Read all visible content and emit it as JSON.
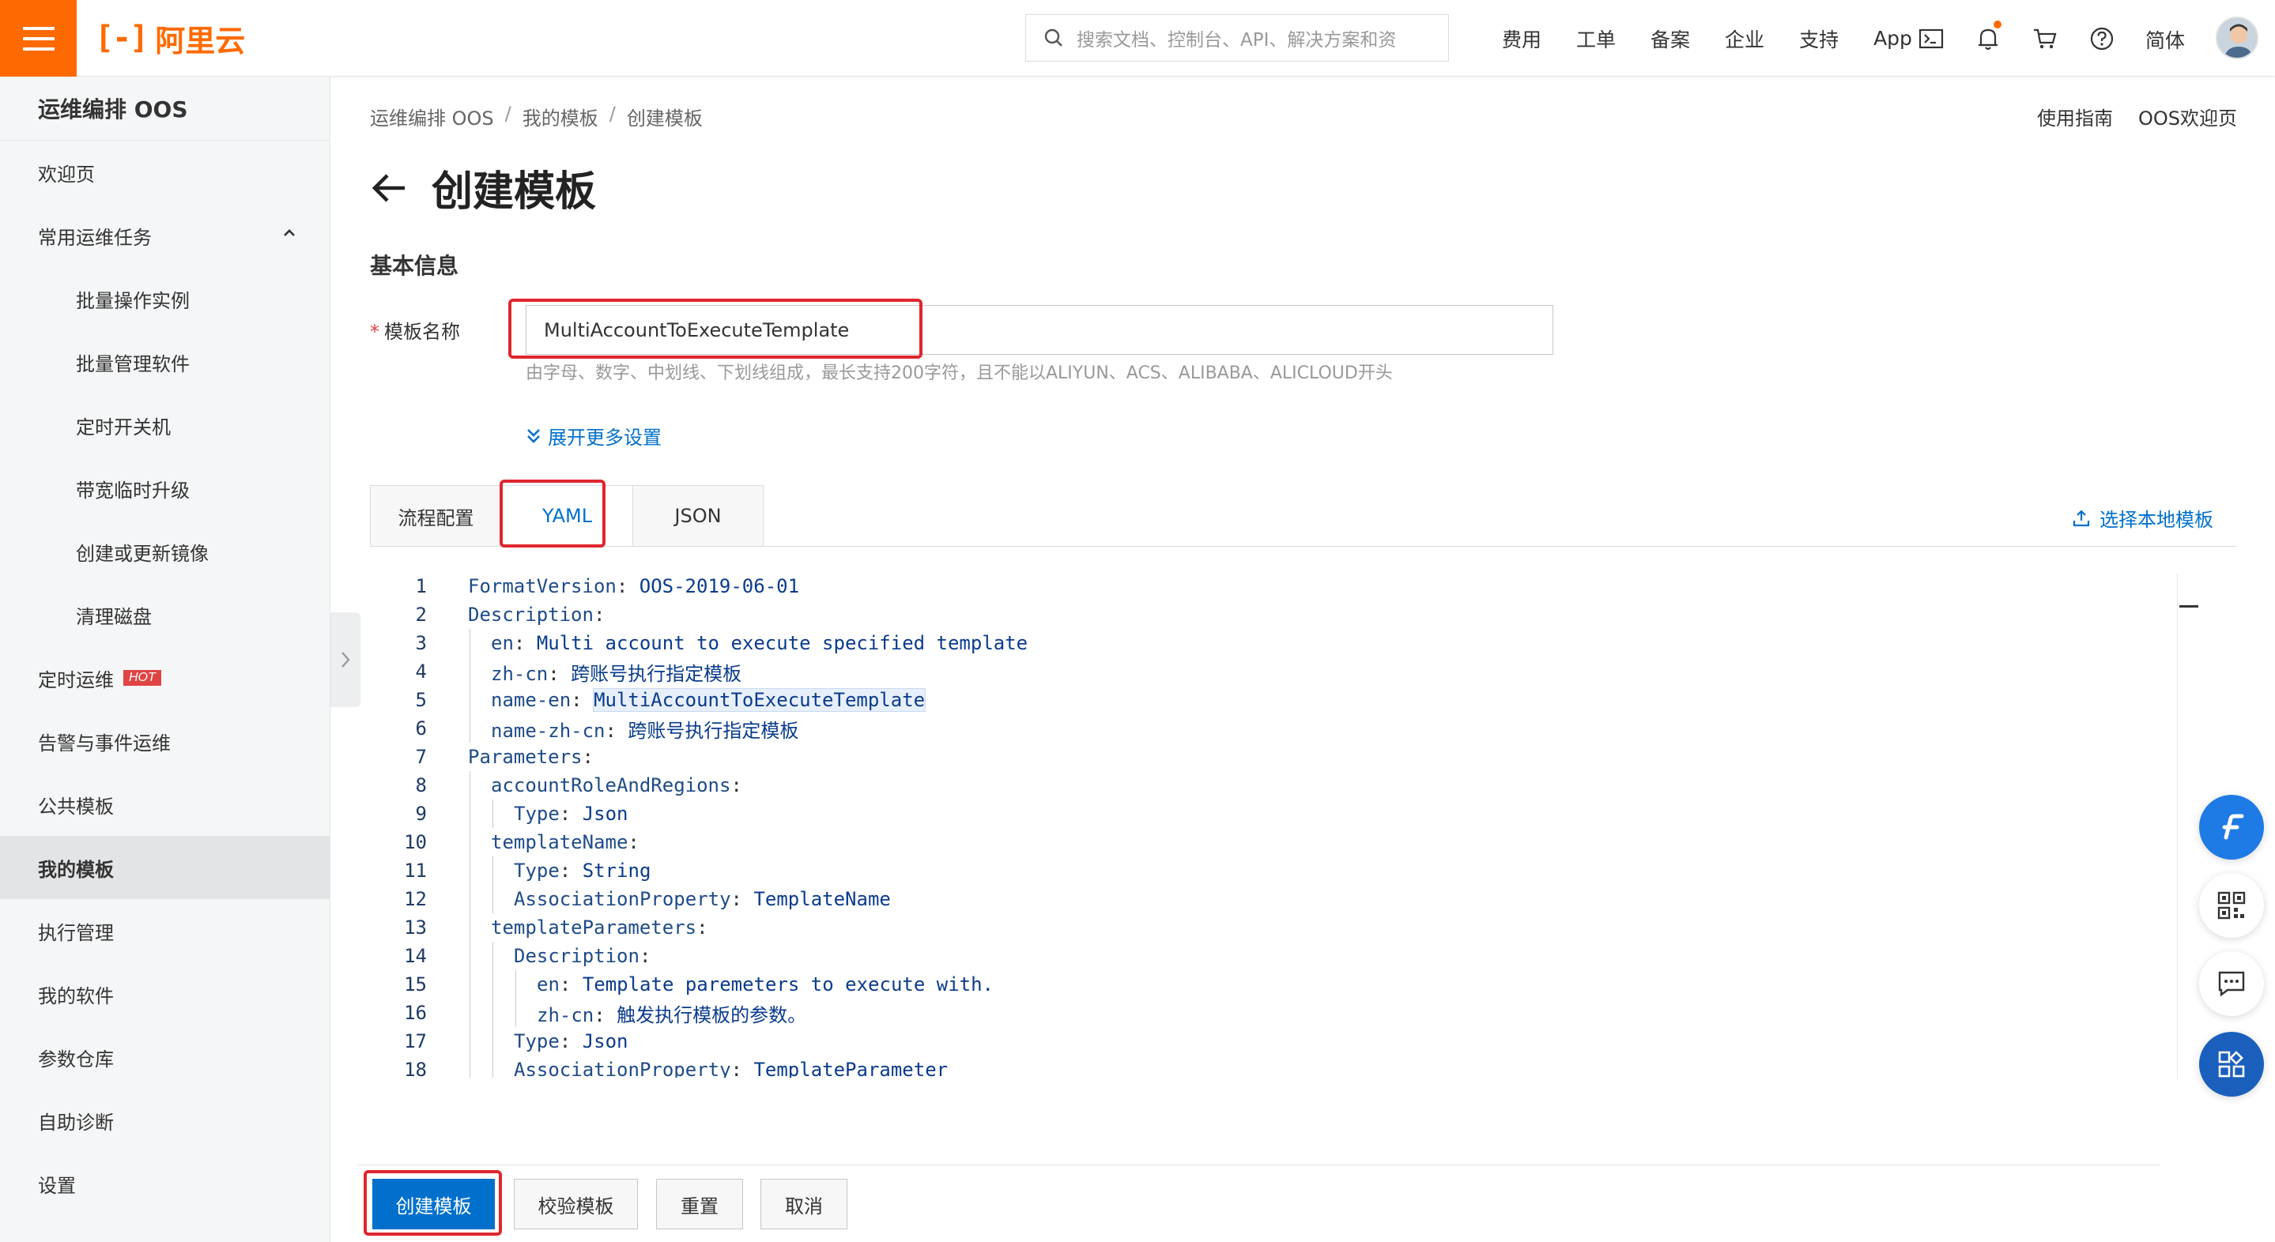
{
  "header": {
    "logo_mark": "[-]",
    "logo_text": "阿里云",
    "search_placeholder": "搜索文档、控制台、API、解决方案和资",
    "links": [
      "费用",
      "工单",
      "备案",
      "企业",
      "支持",
      "App"
    ],
    "language": "简体"
  },
  "sidebar": {
    "title": "运维编排 OOS",
    "items": [
      {
        "label": "欢迎页"
      },
      {
        "label": "常用运维任务"
      },
      {
        "label": "批量操作实例"
      },
      {
        "label": "批量管理软件"
      },
      {
        "label": "定时开关机"
      },
      {
        "label": "带宽临时升级"
      },
      {
        "label": "创建或更新镜像"
      },
      {
        "label": "清理磁盘"
      },
      {
        "label": "定时运维",
        "badge": "HOT"
      },
      {
        "label": "告警与事件运维"
      },
      {
        "label": "公共模板"
      },
      {
        "label": "我的模板"
      },
      {
        "label": "执行管理"
      },
      {
        "label": "我的软件"
      },
      {
        "label": "参数仓库"
      },
      {
        "label": "自助诊断"
      },
      {
        "label": "设置"
      }
    ]
  },
  "breadcrumb": [
    "运维编排 OOS",
    "我的模板",
    "创建模板"
  ],
  "help_links": [
    "使用指南",
    "OOS欢迎页"
  ],
  "page_title": "创建模板",
  "section_title": "基本信息",
  "form": {
    "name_label": "模板名称",
    "name_value": "MultiAccountToExecuteTemplate",
    "name_hint": "由字母、数字、中划线、下划线组成，最长支持200字符，且不能以ALIYUN、ACS、ALIBABA、ALICLOUD开头",
    "expand_label": "展开更多设置"
  },
  "tabs": [
    "流程配置",
    "YAML",
    "JSON"
  ],
  "active_tab": "YAML",
  "local_template": "选择本地模板",
  "code_lines": [
    {
      "n": "1",
      "indent": 0,
      "key": "FormatVersion",
      "value": "OOS-2019-06-01"
    },
    {
      "n": "2",
      "indent": 0,
      "key": "Description",
      "value": ""
    },
    {
      "n": "3",
      "indent": 1,
      "key": "en",
      "value": "Multi account to execute specified template"
    },
    {
      "n": "4",
      "indent": 1,
      "key": "zh-cn",
      "value": "跨账号执行指定模板"
    },
    {
      "n": "5",
      "indent": 1,
      "key": "name-en",
      "value": "MultiAccountToExecuteTemplate",
      "highlight": true
    },
    {
      "n": "6",
      "indent": 1,
      "key": "name-zh-cn",
      "value": "跨账号执行指定模板"
    },
    {
      "n": "7",
      "indent": 0,
      "key": "Parameters",
      "value": ""
    },
    {
      "n": "8",
      "indent": 1,
      "key": "accountRoleAndRegions",
      "value": ""
    },
    {
      "n": "9",
      "indent": 2,
      "key": "Type",
      "value": "Json"
    },
    {
      "n": "10",
      "indent": 1,
      "key": "templateName",
      "value": ""
    },
    {
      "n": "11",
      "indent": 2,
      "key": "Type",
      "value": "String"
    },
    {
      "n": "12",
      "indent": 2,
      "key": "AssociationProperty",
      "value": "TemplateName"
    },
    {
      "n": "13",
      "indent": 1,
      "key": "templateParameters",
      "value": ""
    },
    {
      "n": "14",
      "indent": 2,
      "key": "Description",
      "value": ""
    },
    {
      "n": "15",
      "indent": 3,
      "key": "en",
      "value": "Template paremeters to execute with."
    },
    {
      "n": "16",
      "indent": 3,
      "key": "zh-cn",
      "value": "触发执行模板的参数。"
    },
    {
      "n": "17",
      "indent": 2,
      "key": "Type",
      "value": "Json"
    },
    {
      "n": "18",
      "indent": 2,
      "key": "AssociationProperty",
      "value": "TemplateParameter"
    }
  ],
  "buttons": {
    "create": "创建模板",
    "validate": "校验模板",
    "reset": "重置",
    "cancel": "取消"
  },
  "colors": {
    "brand": "#ff6a00",
    "primary": "#0070cc",
    "highlight_box": "#e0262e"
  }
}
